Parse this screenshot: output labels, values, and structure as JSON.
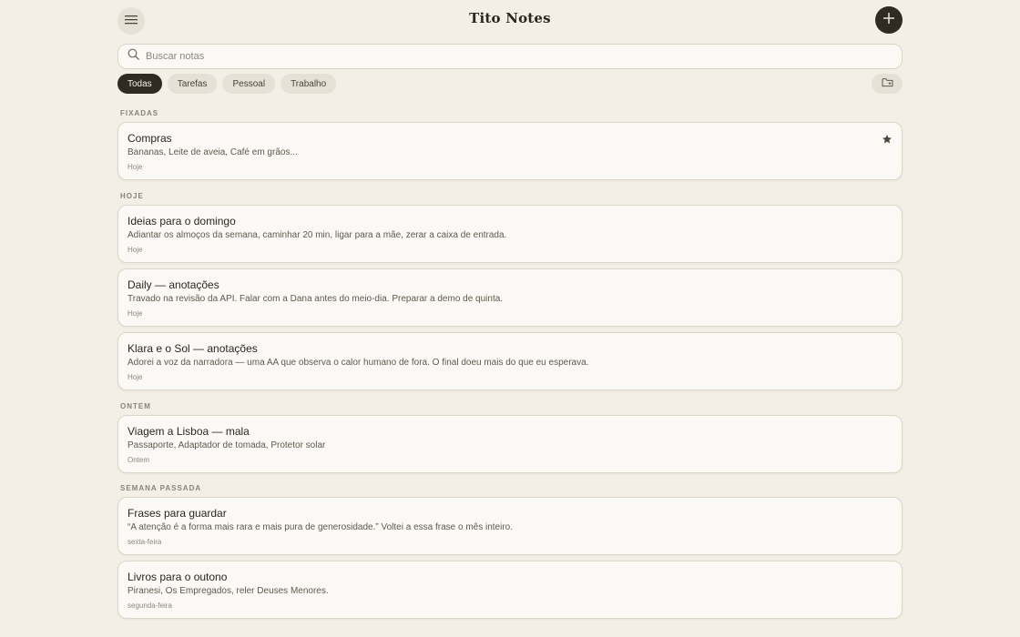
{
  "app": {
    "title": "Tito Notes"
  },
  "icons": {
    "menu": "menu-icon",
    "add": "plus-icon",
    "search": "search-icon",
    "folder": "folder-icon",
    "pin": "star-icon"
  },
  "colors": {
    "background": "#f3efe7",
    "accent_dark": "#2f2a22",
    "chip": "#e6e1d7",
    "card": "#fbf9f5"
  },
  "search": {
    "placeholder": "Buscar notas",
    "value": ""
  },
  "filters": [
    {
      "label": "Todas",
      "active": true
    },
    {
      "label": "Tarefas",
      "active": false
    },
    {
      "label": "Pessoal",
      "active": false
    },
    {
      "label": "Trabalho",
      "active": false
    }
  ],
  "sections": {
    "pinned": "FIXADAS",
    "today": "HOJE",
    "yesterday": "ONTEM",
    "last_week": "SEMANA PASSADA"
  },
  "notes": [
    {
      "title": "Compras",
      "preview": "Bananas, Leite de aveia, Café em grãos...",
      "date": "Hoje",
      "pinned": true
    },
    {
      "title": "Ideias para o domingo",
      "preview": "Adiantar os almoços da semana, caminhar 20 min, ligar para a mãe, zerar a caixa de entrada.",
      "date": "Hoje",
      "pinned": false
    },
    {
      "title": "Daily — anotações",
      "preview": "Travado na revisão da API. Falar com a Dana antes do meio-dia. Preparar a demo de quinta.",
      "date": "Hoje",
      "pinned": false
    },
    {
      "title": "Klara e o Sol — anotações",
      "preview": "Adorei a voz da narradora — uma AA que observa o calor humano de fora. O final doeu mais do que eu esperava.",
      "date": "Hoje",
      "pinned": false
    },
    {
      "title": "Viagem a Lisboa — mala",
      "preview": "Passaporte, Adaptador de tomada, Protetor solar",
      "date": "Ontem",
      "pinned": false
    },
    {
      "title": "Frases para guardar",
      "preview": "“A atenção é a forma mais rara e mais pura de generosidade.” Voltei a essa frase o mês inteiro.",
      "date": "sexta-feira",
      "pinned": false
    },
    {
      "title": "Livros para o outono",
      "preview": "Piranesi, Os Empregados, reler Deuses Menores.",
      "date": "segunda-feira",
      "pinned": false
    }
  ]
}
